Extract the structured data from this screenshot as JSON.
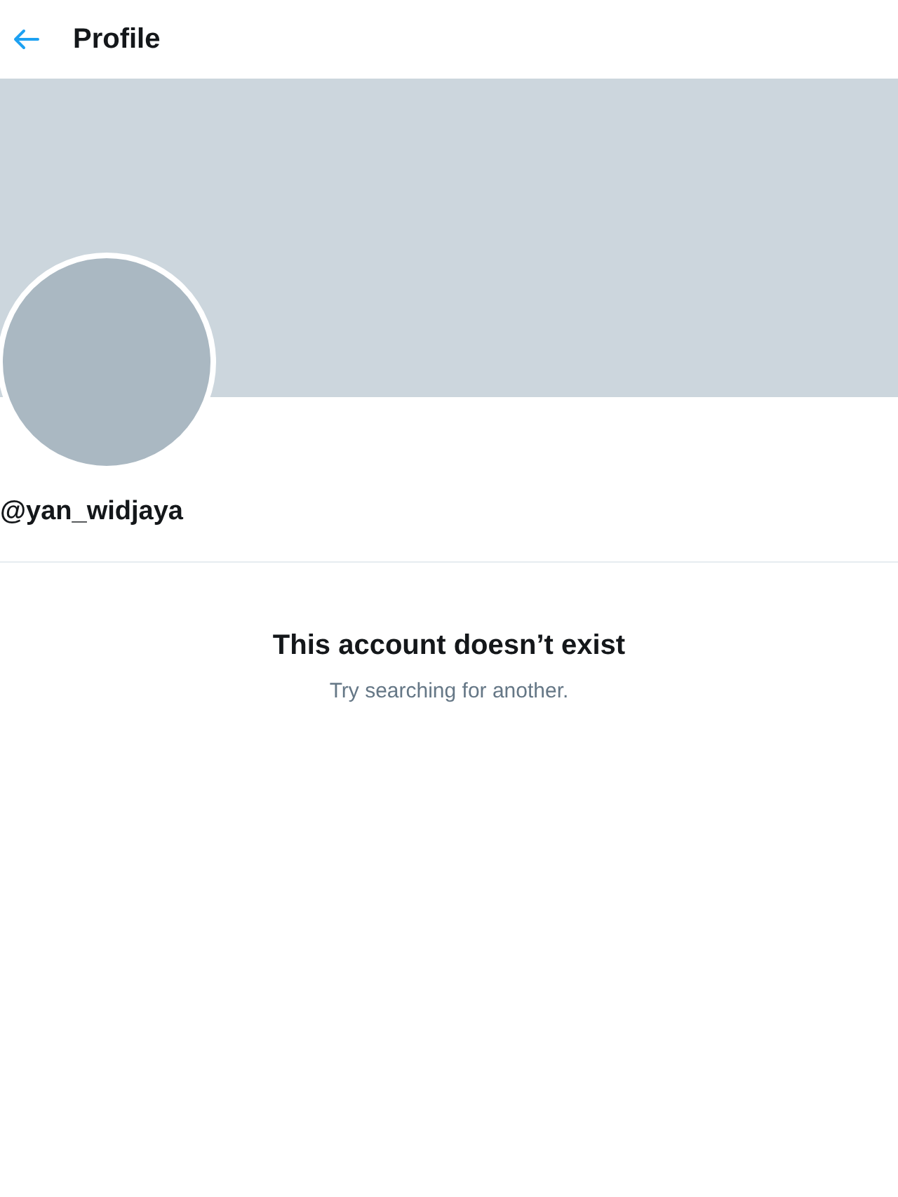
{
  "header": {
    "title": "Profile"
  },
  "profile": {
    "handle": "@yan_widjaya"
  },
  "empty_state": {
    "title": "This account doesn’t exist",
    "subtitle": "Try searching for another."
  }
}
